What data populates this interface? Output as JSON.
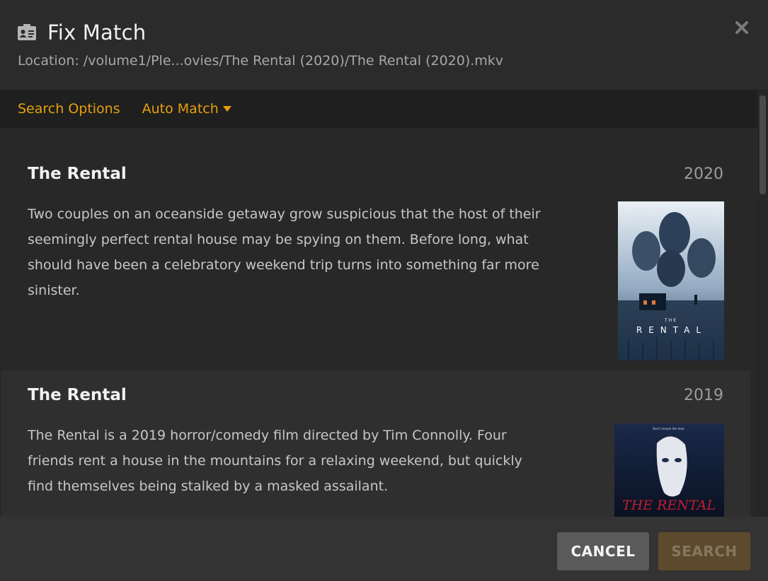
{
  "dialog": {
    "title": "Fix Match",
    "location": "Location: /volume1/Ple...ovies/The Rental (2020)/The Rental (2020).mkv",
    "icon": "id-card-icon",
    "close_icon": "close-icon"
  },
  "toolbar": {
    "search_options": "Search Options",
    "auto_match": "Auto Match",
    "accent_color": "#e5a00d"
  },
  "results": [
    {
      "title": "The Rental",
      "year": "2020",
      "summary": "Two couples on an oceanside getaway grow suspicious that the host of their seemingly perfect rental house may be spying on them. Before long, what should have been a celebratory weekend trip turns into something far more sinister.",
      "poster": {
        "small_text": "THE",
        "title_text": "RENTAL"
      }
    },
    {
      "title": "The Rental",
      "year": "2019",
      "summary": "The Rental is a 2019 horror/comedy film directed by Tim Connolly. Four friends rent a house in the mountains for a relaxing weekend, but quickly find themselves being stalked by a masked assailant.",
      "poster": {
        "tagline": "Don't answer the door.",
        "title_text": "THE RENTAL"
      }
    }
  ],
  "footer": {
    "cancel": "CANCEL",
    "search": "SEARCH"
  }
}
